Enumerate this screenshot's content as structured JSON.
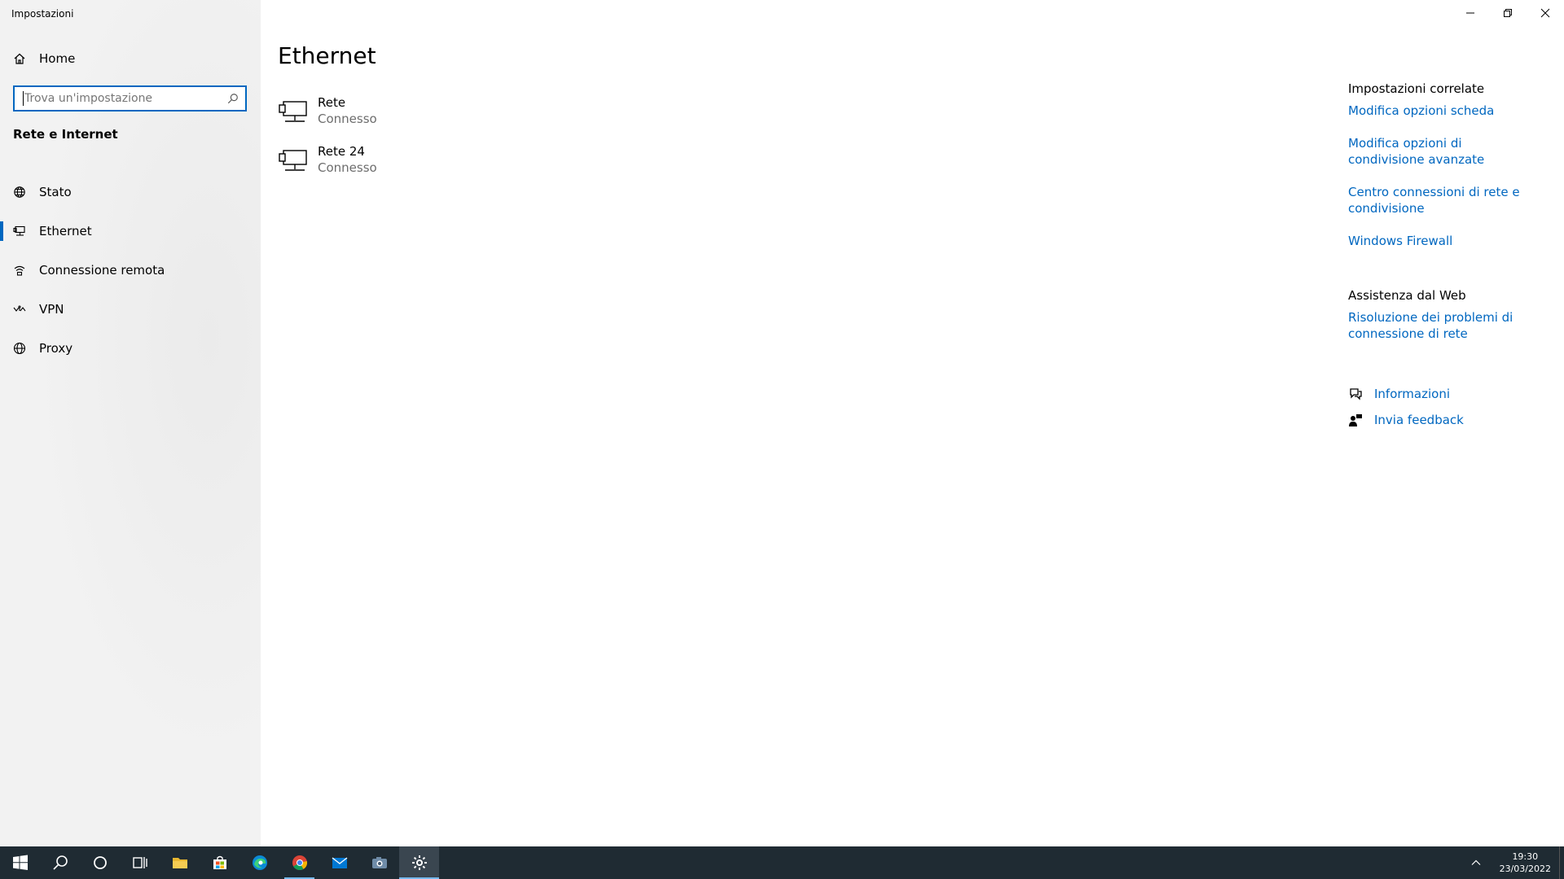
{
  "window": {
    "title": "Impostazioni"
  },
  "sidebar": {
    "home_label": "Home",
    "search_placeholder": "Trova un'impostazione",
    "section_title": "Rete e Internet",
    "items": [
      {
        "label": "Stato",
        "icon": "globe-status-icon"
      },
      {
        "label": "Ethernet",
        "icon": "ethernet-icon",
        "selected": true
      },
      {
        "label": "Connessione remota",
        "icon": "dialup-icon"
      },
      {
        "label": "VPN",
        "icon": "vpn-icon"
      },
      {
        "label": "Proxy",
        "icon": "globe-icon"
      }
    ]
  },
  "main": {
    "title": "Ethernet",
    "networks": [
      {
        "name": "Rete",
        "status": "Connesso"
      },
      {
        "name": "Rete 24",
        "status": "Connesso"
      }
    ]
  },
  "related": {
    "title": "Impostazioni correlate",
    "links": [
      "Modifica opzioni scheda",
      "Modifica opzioni di condivisione avanzate",
      "Centro connessioni di rete e condivisione",
      "Windows Firewall"
    ]
  },
  "web_help": {
    "title": "Assistenza dal Web",
    "links": [
      "Risoluzione dei problemi di connessione di rete"
    ]
  },
  "help": {
    "info_label": "Informazioni",
    "feedback_label": "Invia feedback"
  },
  "taskbar": {
    "time": "19:30",
    "date": "23/03/2022",
    "accent": "#76b9ed"
  },
  "colors": {
    "link": "#0067c0",
    "accent": "#0067c0"
  }
}
